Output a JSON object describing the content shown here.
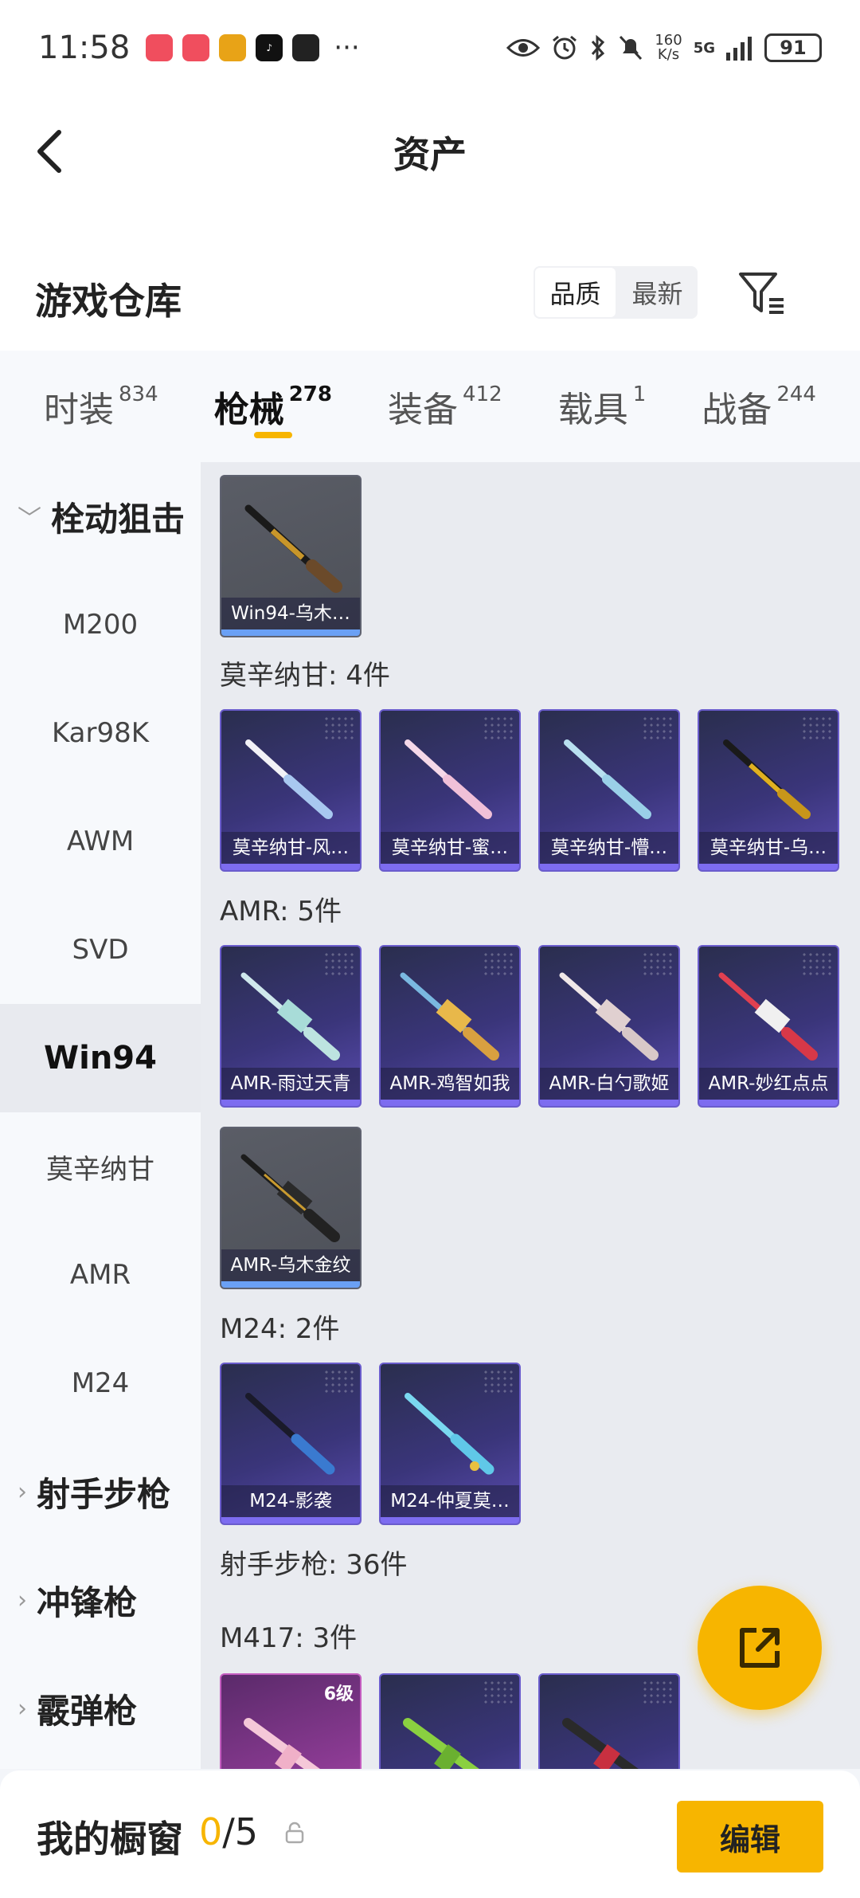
{
  "status": {
    "time": "11:58",
    "net_speed_top": "160",
    "net_speed_bottom": "K/s",
    "network": "5G",
    "battery": "91"
  },
  "header": {
    "title": "资产"
  },
  "warehouse": {
    "title": "游戏仓库",
    "sort_options": [
      "品质",
      "最新"
    ],
    "sort_selected": "品质"
  },
  "tabs": [
    {
      "label": "时装",
      "count": "834"
    },
    {
      "label": "枪械",
      "count": "278"
    },
    {
      "label": "装备",
      "count": "412"
    },
    {
      "label": "载具",
      "count": "1"
    },
    {
      "label": "战备",
      "count": "244"
    }
  ],
  "sidebar": [
    {
      "label": "栓动狙击",
      "type": "group",
      "expanded": true
    },
    {
      "label": "M200"
    },
    {
      "label": "Kar98K"
    },
    {
      "label": "AWM"
    },
    {
      "label": "SVD"
    },
    {
      "label": "Win94",
      "selected": true
    },
    {
      "label": "莫辛纳甘"
    },
    {
      "label": "AMR"
    },
    {
      "label": "M24"
    },
    {
      "label": "射手步枪",
      "type": "group"
    },
    {
      "label": "冲锋枪",
      "type": "group"
    },
    {
      "label": "霰弹枪",
      "type": "group"
    }
  ],
  "content": {
    "win94_items": [
      {
        "name": "Win94-乌木…"
      }
    ],
    "mosin_title": "莫辛纳甘: 4件",
    "mosin_items": [
      {
        "name": "莫辛纳甘-风…"
      },
      {
        "name": "莫辛纳甘-蜜…"
      },
      {
        "name": "莫辛纳甘-懵…"
      },
      {
        "name": "莫辛纳甘-乌…"
      }
    ],
    "amr_title": "AMR: 5件",
    "amr_items": [
      {
        "name": "AMR-雨过天青"
      },
      {
        "name": "AMR-鸡智如我"
      },
      {
        "name": "AMR-白勺歌姬"
      },
      {
        "name": "AMR-妙红点点"
      },
      {
        "name": "AMR-乌木金纹"
      }
    ],
    "m24_title": "M24: 2件",
    "m24_items": [
      {
        "name": "M24-影袭"
      },
      {
        "name": "M24-仲夏莫…"
      }
    ],
    "marksman_title": "射手步枪: 36件",
    "m417_title": "M417: 3件",
    "m417_level": "6级"
  },
  "bottom": {
    "title": "我的橱窗",
    "current": "0",
    "total": "/5",
    "edit_label": "编辑"
  },
  "colors": {
    "accent": "#f7b500",
    "card_purple": "#3a357a",
    "card_grey": "#555860"
  }
}
